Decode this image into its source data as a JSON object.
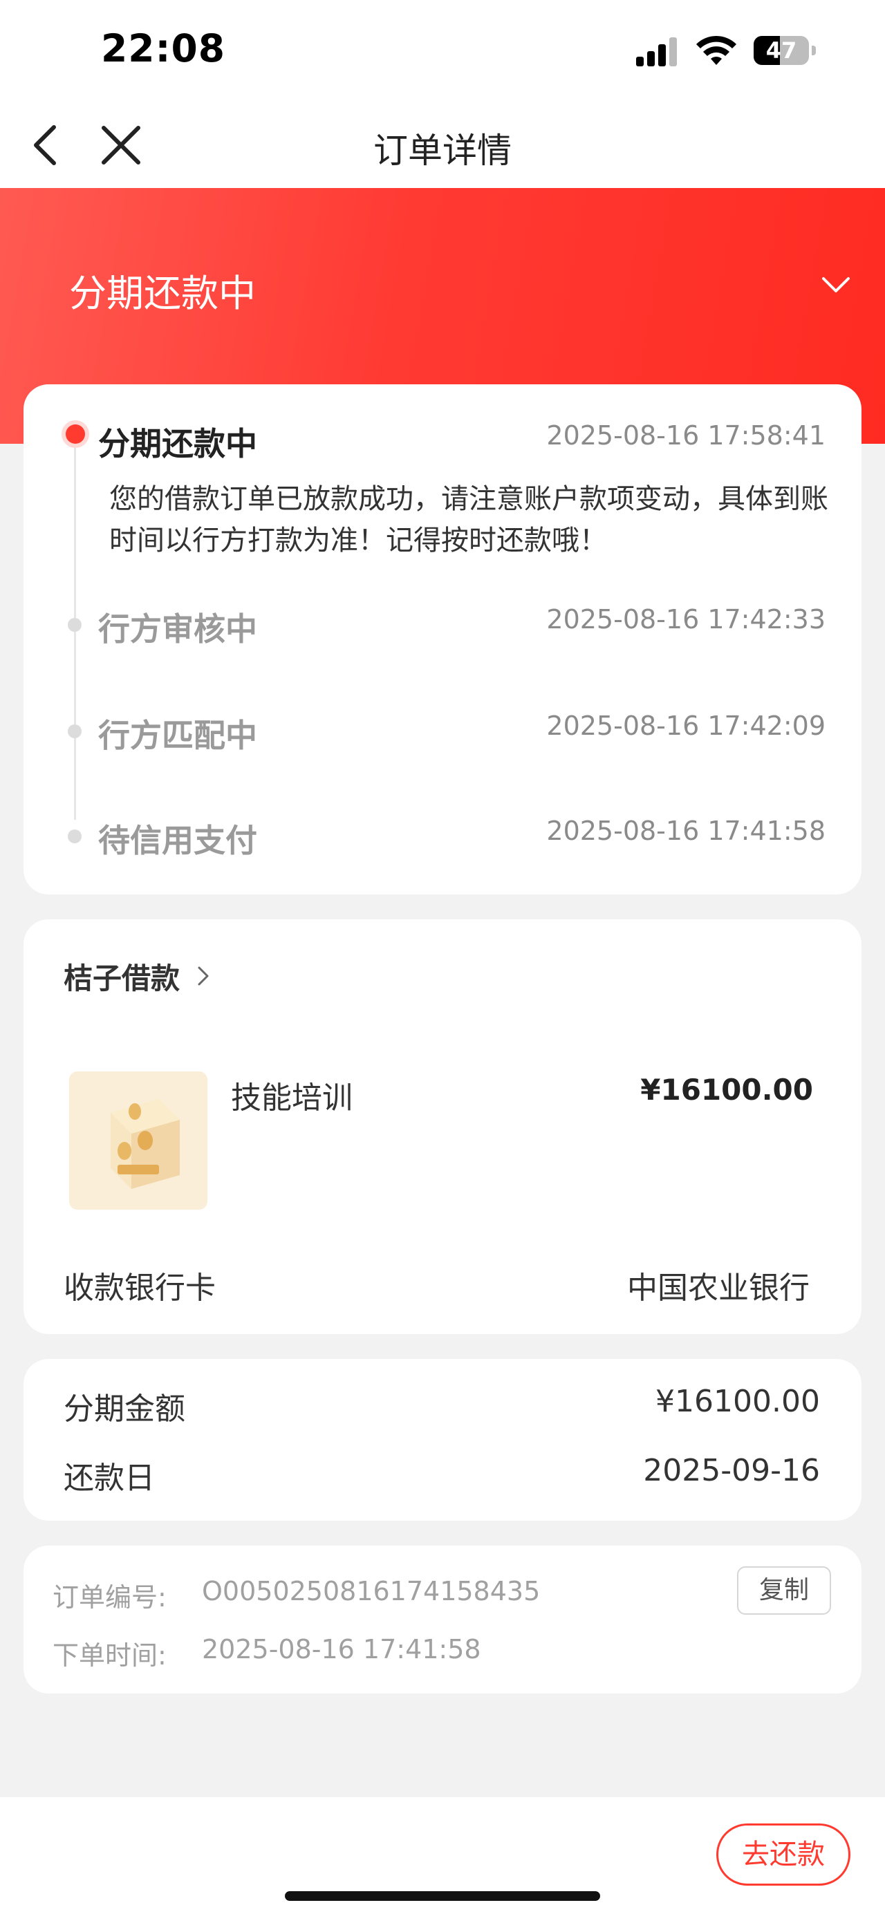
{
  "status_bar": {
    "time": "22:08",
    "battery_level": "47",
    "battery_fraction": 0.47,
    "icons": [
      "signal-icon",
      "wifi-icon",
      "battery-icon"
    ]
  },
  "nav": {
    "title": "订单详情",
    "back_icon": "chevron-left-icon",
    "close_icon": "close-icon"
  },
  "banner": {
    "status_title": "分期还款中",
    "expand_icon": "chevron-down-icon"
  },
  "timeline": [
    {
      "title": "分期还款中",
      "time": "2025-08-16 17:58:41",
      "description": "您的借款订单已放款成功，请注意账户款项变动，具体到账时间以行方打款为准！记得按时还款哦！",
      "active": true
    },
    {
      "title": "行方审核中",
      "time": "2025-08-16 17:42:33",
      "active": false
    },
    {
      "title": "行方匹配中",
      "time": "2025-08-16 17:42:09",
      "active": false
    },
    {
      "title": "待信用支付",
      "time": "2025-08-16 17:41:58",
      "active": false
    }
  ],
  "product_card": {
    "merchant": "桔子借款",
    "product_name": "技能培训",
    "price": "¥16100.00",
    "bank_label": "收款银行卡",
    "bank_value": "中国农业银行"
  },
  "amount_card": {
    "installment_label": "分期金额",
    "installment_value": "¥16100.00",
    "due_label": "还款日",
    "due_value": "2025-09-16"
  },
  "order_card": {
    "order_no_label": "订单编号:",
    "order_no_value": "O0050250816174158435",
    "copy_label": "复制",
    "order_time_label": "下单时间:",
    "order_time_value": "2025-08-16 17:41:58"
  },
  "bottom": {
    "repay_label": "去还款"
  },
  "colors": {
    "accent": "#ff3b30",
    "banner_start": "#ff5a52",
    "banner_end": "#ff2b22",
    "background": "#f2f2f2"
  }
}
